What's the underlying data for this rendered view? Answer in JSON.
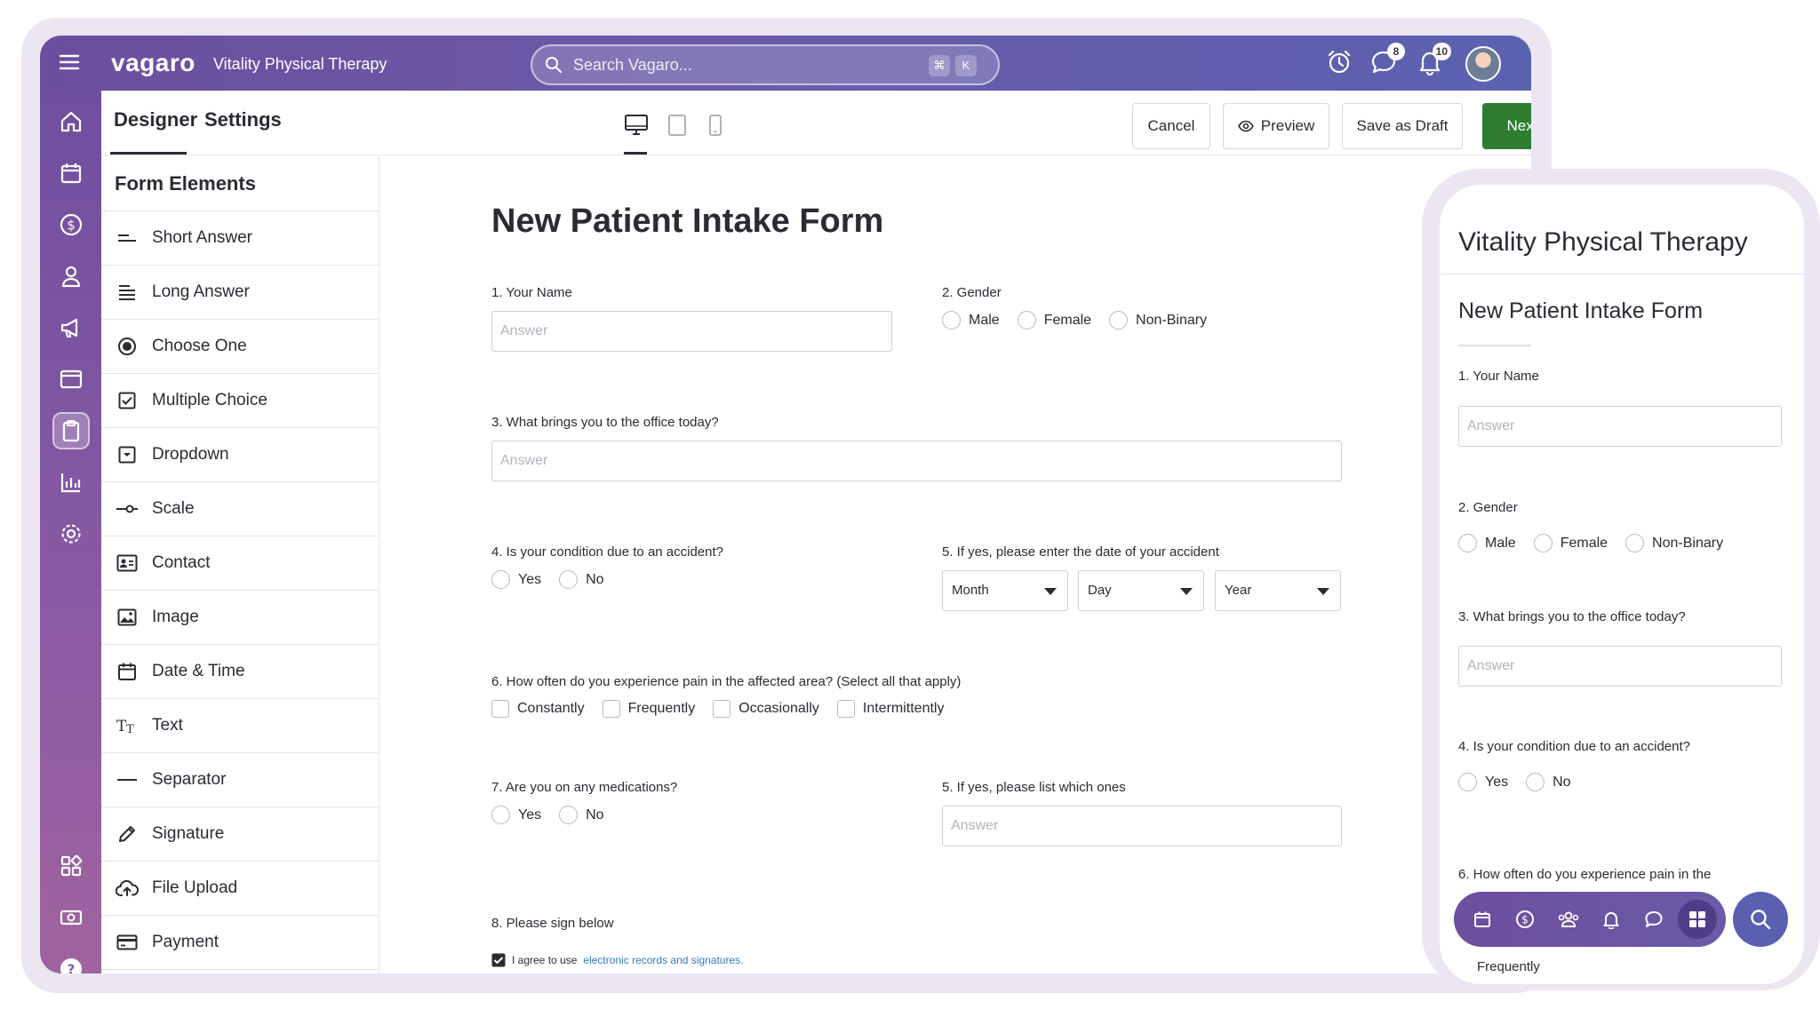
{
  "app": {
    "logo": "vagaro",
    "business_name": "Vitality Physical Therapy"
  },
  "search": {
    "placeholder": "Search Vagaro...",
    "shortcut_1": "⌘",
    "shortcut_2": "K"
  },
  "topbar": {
    "messages_badge": "8",
    "notifications_badge": "10"
  },
  "rail": {
    "icons": [
      "home-icon",
      "calendar-icon",
      "dollar-icon",
      "person-icon",
      "megaphone-icon",
      "browser-icon",
      "clipboard-icon",
      "chart-icon",
      "gear-icon",
      "apps-grid-icon",
      "cash-icon",
      "help-icon"
    ],
    "active": "clipboard-icon"
  },
  "header": {
    "tabs": [
      "Designer",
      "Settings"
    ],
    "active_tab": "Designer",
    "devices": [
      "desktop-icon",
      "tablet-icon",
      "phone-icon"
    ],
    "active_device": "desktop-icon",
    "cancel": "Cancel",
    "preview": "Preview",
    "save_draft": "Save as Draft",
    "next": "Next",
    "next_color": "#2e7d32"
  },
  "elements_panel": {
    "title": "Form Elements",
    "items": [
      {
        "label": "Short Answer",
        "icon": "short-answer-icon"
      },
      {
        "label": "Long Answer",
        "icon": "long-answer-icon"
      },
      {
        "label": "Choose One",
        "icon": "radio-icon"
      },
      {
        "label": "Multiple Choice",
        "icon": "checkbox-icon"
      },
      {
        "label": "Dropdown",
        "icon": "dropdown-icon"
      },
      {
        "label": "Scale",
        "icon": "scale-icon"
      },
      {
        "label": "Contact",
        "icon": "contact-card-icon"
      },
      {
        "label": "Image",
        "icon": "image-icon"
      },
      {
        "label": "Date & Time",
        "icon": "calendar-icon"
      },
      {
        "label": "Text",
        "icon": "text-icon"
      },
      {
        "label": "Separator",
        "icon": "separator-icon"
      },
      {
        "label": "Signature",
        "icon": "pen-icon"
      },
      {
        "label": "File Upload",
        "icon": "cloud-upload-icon"
      },
      {
        "label": "Payment",
        "icon": "credit-card-icon"
      }
    ]
  },
  "form": {
    "title": "New Patient Intake Form",
    "q1": "1. Your Name",
    "q2": "2. Gender",
    "q3": "3. What brings you to the office today?",
    "q4": "4. Is your condition due to an accident?",
    "q5": "5. If yes, please enter the date of your accident",
    "q6": "6. How often do you experience pain in the affected area? (Select all that apply)",
    "q7": "7. Are you on any medications?",
    "q7b": "5. If yes, please list which ones",
    "q8": "8. Please sign below",
    "answer_placeholder": "Answer",
    "gender_options": [
      "Male",
      "Female",
      "Non-Binary"
    ],
    "yes_no": [
      "Yes",
      "No"
    ],
    "date_selects": [
      "Month",
      "Day",
      "Year"
    ],
    "pain_options": [
      "Constantly",
      "Frequently",
      "Occasionally",
      "Intermittently"
    ],
    "agree_prefix": "I agree to use",
    "agree_link": "electronic records and signatures.",
    "link_color": "#2f7cc0"
  },
  "phone": {
    "business_name": "Vitality Physical Therapy",
    "form_title": "New Patient Intake Form",
    "q1": "1. Your Name",
    "q2": "2. Gender",
    "q3": "3. What brings you to the office today?",
    "q4": "4. Is your condition due to an accident?",
    "q6": "6. How often do you experience pain in the",
    "answer_placeholder": "Answer",
    "gender_options": [
      "Male",
      "Female",
      "Non-Binary"
    ],
    "yes_no": [
      "Yes",
      "No"
    ],
    "partial_option": "Frequently",
    "nav_icons": [
      "calendar-icon",
      "dollar-icon",
      "people-icon",
      "bell-icon",
      "chat-icon",
      "apps-grid-icon"
    ],
    "active_nav": "apps-grid-icon"
  }
}
